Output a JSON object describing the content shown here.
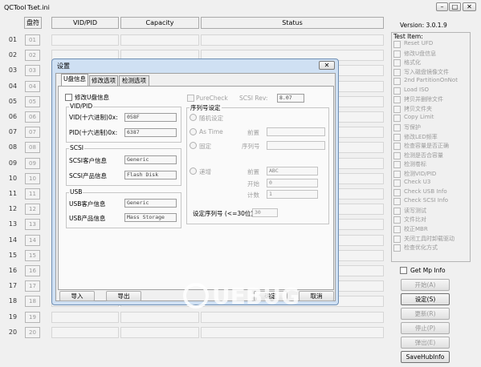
{
  "app": {
    "title": "QCTool",
    "file": "Tset.ini"
  },
  "window_buttons": {
    "minimize": "–",
    "maximize": "□",
    "close": "✕"
  },
  "grid": {
    "headers": {
      "port": "盘符",
      "vid_pid": "VID/PID",
      "capacity": "Capacity",
      "status": "Status"
    },
    "rows": [
      {
        "num": "01",
        "btn": "01"
      },
      {
        "num": "02",
        "btn": "02"
      },
      {
        "num": "03",
        "btn": "03"
      },
      {
        "num": "04",
        "btn": "04"
      },
      {
        "num": "05",
        "btn": "05"
      },
      {
        "num": "06",
        "btn": "06"
      },
      {
        "num": "07",
        "btn": "07"
      },
      {
        "num": "08",
        "btn": "08"
      },
      {
        "num": "09",
        "btn": "09"
      },
      {
        "num": "10",
        "btn": "10"
      },
      {
        "num": "11",
        "btn": "11"
      },
      {
        "num": "12",
        "btn": "12"
      },
      {
        "num": "13",
        "btn": "13"
      },
      {
        "num": "14",
        "btn": "14"
      },
      {
        "num": "15",
        "btn": "15"
      },
      {
        "num": "16",
        "btn": "16"
      },
      {
        "num": "17",
        "btn": "17"
      },
      {
        "num": "18",
        "btn": "18"
      },
      {
        "num": "19",
        "btn": "19"
      },
      {
        "num": "20",
        "btn": "20"
      }
    ]
  },
  "right_panel": {
    "version": "Version: 3.0.1.9",
    "test_item_title": "Test Item:",
    "test_items": [
      "Reset UFD",
      "修改U盘信息",
      "格式化",
      "写入磁盘镜像文件",
      "2nd PartitionOnNot",
      "Load ISO",
      "拷贝并删除文件",
      "拷贝文件夹",
      "Copy Limit",
      "写保护",
      "修改LED频率",
      "检查容量是否正确",
      "检测是否合容量",
      "检测卷标",
      "检测VID/PID",
      "Check U3",
      "Check USB Info",
      "Check SCSI Info",
      "读写测试",
      "文件比对",
      "校正MBR",
      "关闭工具时卸载驱动",
      "检查优化方式"
    ],
    "get_mp_info": "Get Mp Info",
    "buttons": {
      "start": "开始(A)",
      "settings": "设定(S)",
      "update": "更新(R)",
      "stop": "停止(P)",
      "eject": "弹出(E)",
      "save_hub": "SaveHubInfo"
    }
  },
  "dialog": {
    "title": "设置",
    "close": "✕",
    "tabs": [
      "U盘信息",
      "修改选项",
      "检测选项"
    ],
    "modify_udisk": "修改U盘信息",
    "vidpid_group": "VID/PID",
    "vid_label": "VID(十六进制)0x:",
    "vid_value": "058F",
    "pid_label": "PID(十六进制)0x:",
    "pid_value": "6387",
    "scsi_group": "SCSI",
    "scsi_vendor_label": "SCSI客户信息",
    "scsi_vendor_value": "Generic",
    "scsi_product_label": "SCSI产品信息",
    "scsi_product_value": "Flash Disk",
    "usb_group": "USB",
    "usb_vendor_label": "USB客户信息",
    "usb_vendor_value": "Generic",
    "usb_product_label": "USB产品信息",
    "usb_product_value": "Mass Storage",
    "purecheck": "PureCheck",
    "scsi_rev_label": "SCSI Rev:",
    "scsi_rev_value": "8.07",
    "serial_group": "序列号设定",
    "random": "随机设定",
    "as_time": "As Time",
    "prefix_label": "前置",
    "fixed": "固定",
    "serial_label": "序列号",
    "increment": "递增",
    "prefix2_label": "前置",
    "prefix2_value": "ABC",
    "start_label": "开始",
    "start_value": "0",
    "count_label": "计数",
    "count_value": "1",
    "serial_len_label": "设定序列号 (<=30位)",
    "serial_len_value": "30",
    "import": "导入",
    "export": "导出",
    "ok": "确定",
    "cancel": "取消"
  },
  "watermark": {
    "text": "UEBUG"
  }
}
